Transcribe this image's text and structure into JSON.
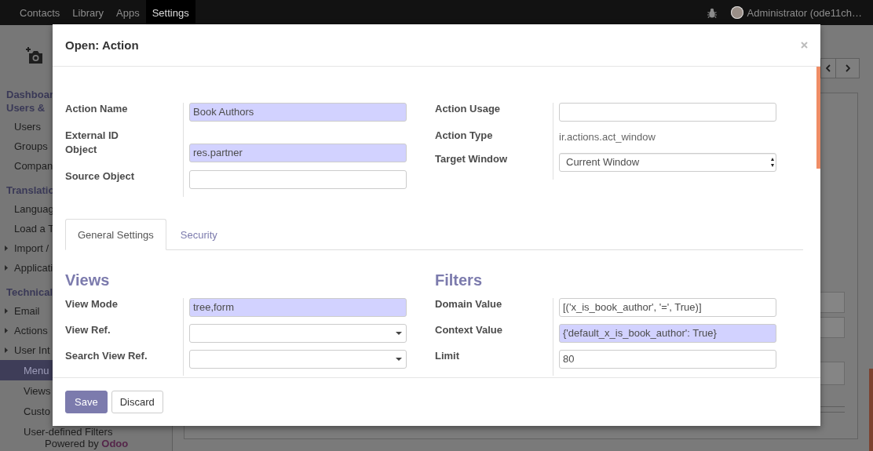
{
  "navbar": {
    "apps": [
      {
        "label": "Contacts",
        "selected": false
      },
      {
        "label": "Library",
        "selected": false
      },
      {
        "label": "Apps",
        "selected": false
      },
      {
        "label": "Settings",
        "selected": true
      }
    ],
    "user": "Administrator (ode11ch…"
  },
  "sidebar": {
    "sections": [
      {
        "title": "Dashboar"
      },
      {
        "title": "Users &",
        "items": [
          {
            "label": "Users",
            "kind": "leaf",
            "selected": false
          },
          {
            "label": "Groups",
            "kind": "leaf",
            "selected": false
          },
          {
            "label": "Compan",
            "kind": "leaf",
            "selected": false
          }
        ]
      },
      {
        "title": "Translatio",
        "items": [
          {
            "label": "Languag",
            "kind": "leaf",
            "selected": false
          },
          {
            "label": "Load a T",
            "kind": "leaf",
            "selected": false
          },
          {
            "label": "Import /",
            "kind": "folder",
            "selected": false
          },
          {
            "label": "Applicati",
            "kind": "folder",
            "selected": false
          }
        ]
      },
      {
        "title": "Technical",
        "items": [
          {
            "label": "Email",
            "kind": "folder",
            "selected": false
          },
          {
            "label": "Actions",
            "kind": "folder",
            "selected": false
          },
          {
            "label": "User Int",
            "kind": "folder",
            "selected": false,
            "children": [
              {
                "label": "Menu",
                "kind": "leaf",
                "selected": true
              },
              {
                "label": "Views",
                "kind": "leaf",
                "selected": false
              },
              {
                "label": "Custo",
                "kind": "leaf",
                "selected": false
              },
              {
                "label": "User-defined Filters",
                "kind": "leaf",
                "selected": false
              }
            ]
          }
        ]
      }
    ],
    "powered_by": "Powered by **Odoo**"
  },
  "dialog": {
    "title": "Open: Action",
    "header_groups": [
      {
        "fields": [
          {
            "label": "Action Name",
            "kind": "input",
            "value": "Book Authors",
            "required": true
          },
          {
            "label": "External ID",
            "kind": "readonly"
          },
          {
            "label": "Object",
            "kind": "input",
            "value": "res.partner",
            "required": true
          },
          {
            "label": "Source Object",
            "kind": "input",
            "required": false
          }
        ]
      },
      {
        "fields": [
          {
            "label": "Action Usage",
            "kind": "input",
            "required": false
          },
          {
            "label": "Action Type",
            "kind": "readonly",
            "value": "ir.actions.act_window"
          },
          {
            "label": "Target Window",
            "kind": "select",
            "value": "Current Window",
            "required": false
          }
        ]
      }
    ],
    "tabs": [
      {
        "label": "General Settings",
        "selected": true
      },
      {
        "label": "Security",
        "selected": false
      }
    ],
    "sections": [
      {
        "title": "Views",
        "fields": [
          {
            "label": "View Mode",
            "kind": "input",
            "value": "tree,form",
            "required": true
          },
          {
            "label": "View Ref.",
            "kind": "lookup",
            "required": false
          },
          {
            "label": "Search View Ref.",
            "kind": "lookup",
            "required": false
          }
        ]
      },
      {
        "title": "Filters",
        "fields": [
          {
            "label": "Domain Value",
            "kind": "input",
            "value": "[('x_is_book_author', '=', True)]",
            "required": false
          },
          {
            "label": "Context Value",
            "kind": "input",
            "value": "{'default_x_is_book_author': True}",
            "required": true
          },
          {
            "label": "Limit",
            "kind": "input",
            "value": "80",
            "required": false
          }
        ]
      }
    ],
    "buttons": [
      {
        "label": "Save",
        "kind": "primary"
      },
      {
        "label": "Discard",
        "kind": "secondary"
      }
    ]
  }
}
